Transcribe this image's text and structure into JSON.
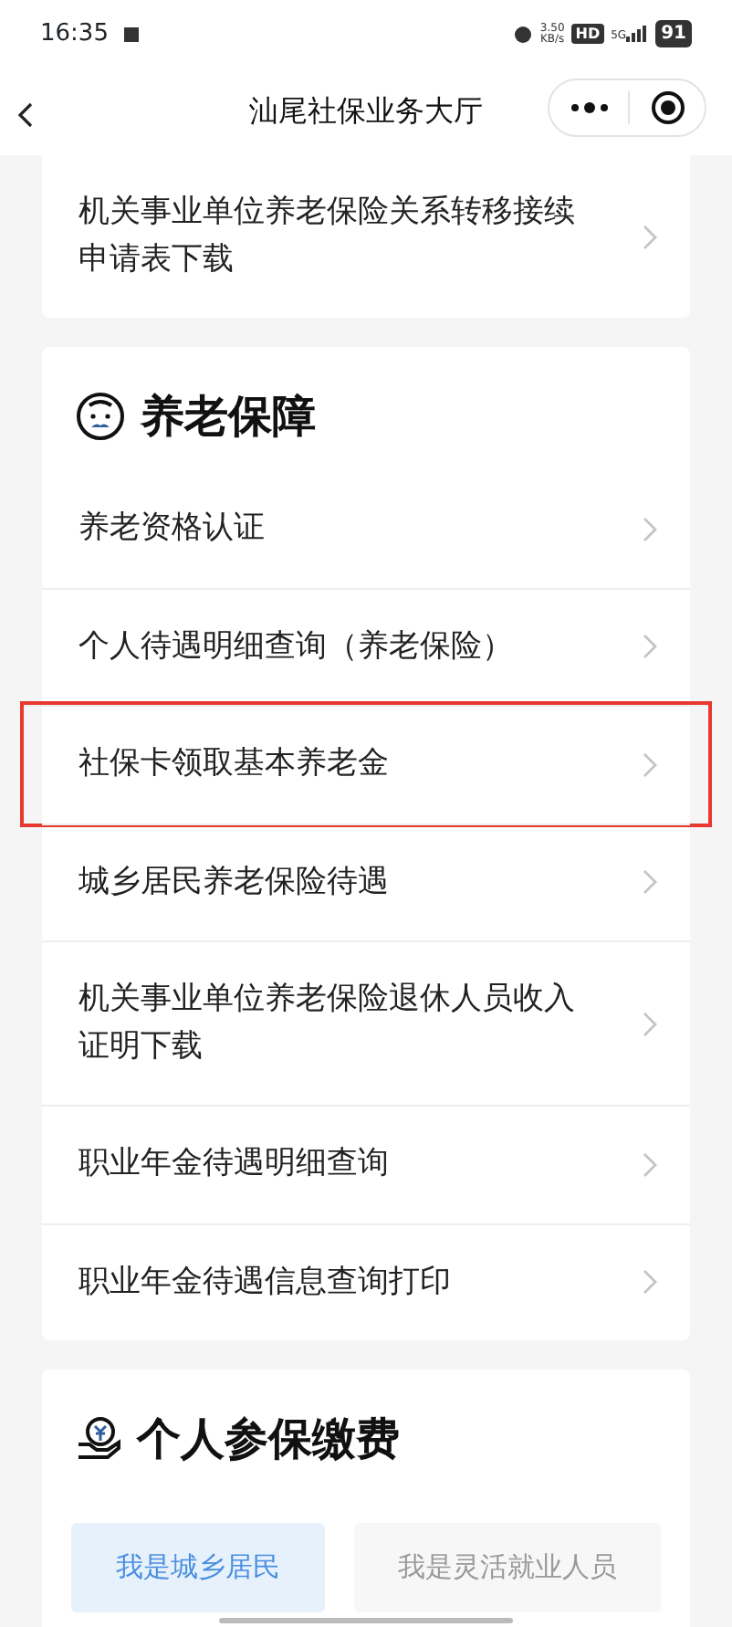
{
  "status_bar": {
    "time": "16:35",
    "speed": "3.50",
    "speed_unit": "KB/s",
    "hd": "HD",
    "network": "5G",
    "battery": "91"
  },
  "nav_bar": {
    "title": "汕尾社保业务大厅"
  },
  "sections": [
    {
      "items": [
        {
          "label": "机关事业单位养老保险关系转移接续申请表下载",
          "highlighted": false
        }
      ]
    },
    {
      "title": "养老保障",
      "items": [
        {
          "label": "养老资格认证",
          "highlighted": false
        },
        {
          "label": "个人待遇明细查询（养老保险）",
          "highlighted": false
        },
        {
          "label": "社保卡领取基本养老金",
          "highlighted": true
        },
        {
          "label": "城乡居民养老保险待遇",
          "highlighted": false
        },
        {
          "label": "机关事业单位养老保险退休人员收入证明下载",
          "highlighted": false
        },
        {
          "label": "职业年金待遇明细查询",
          "highlighted": false
        },
        {
          "label": "职业年金待遇信息查询打印",
          "highlighted": false
        }
      ]
    },
    {
      "title": "个人参保缴费",
      "tabs": [
        {
          "label": "我是城乡居民",
          "selected": true
        },
        {
          "label": "我是灵活就业人员",
          "selected": false
        }
      ]
    }
  ]
}
